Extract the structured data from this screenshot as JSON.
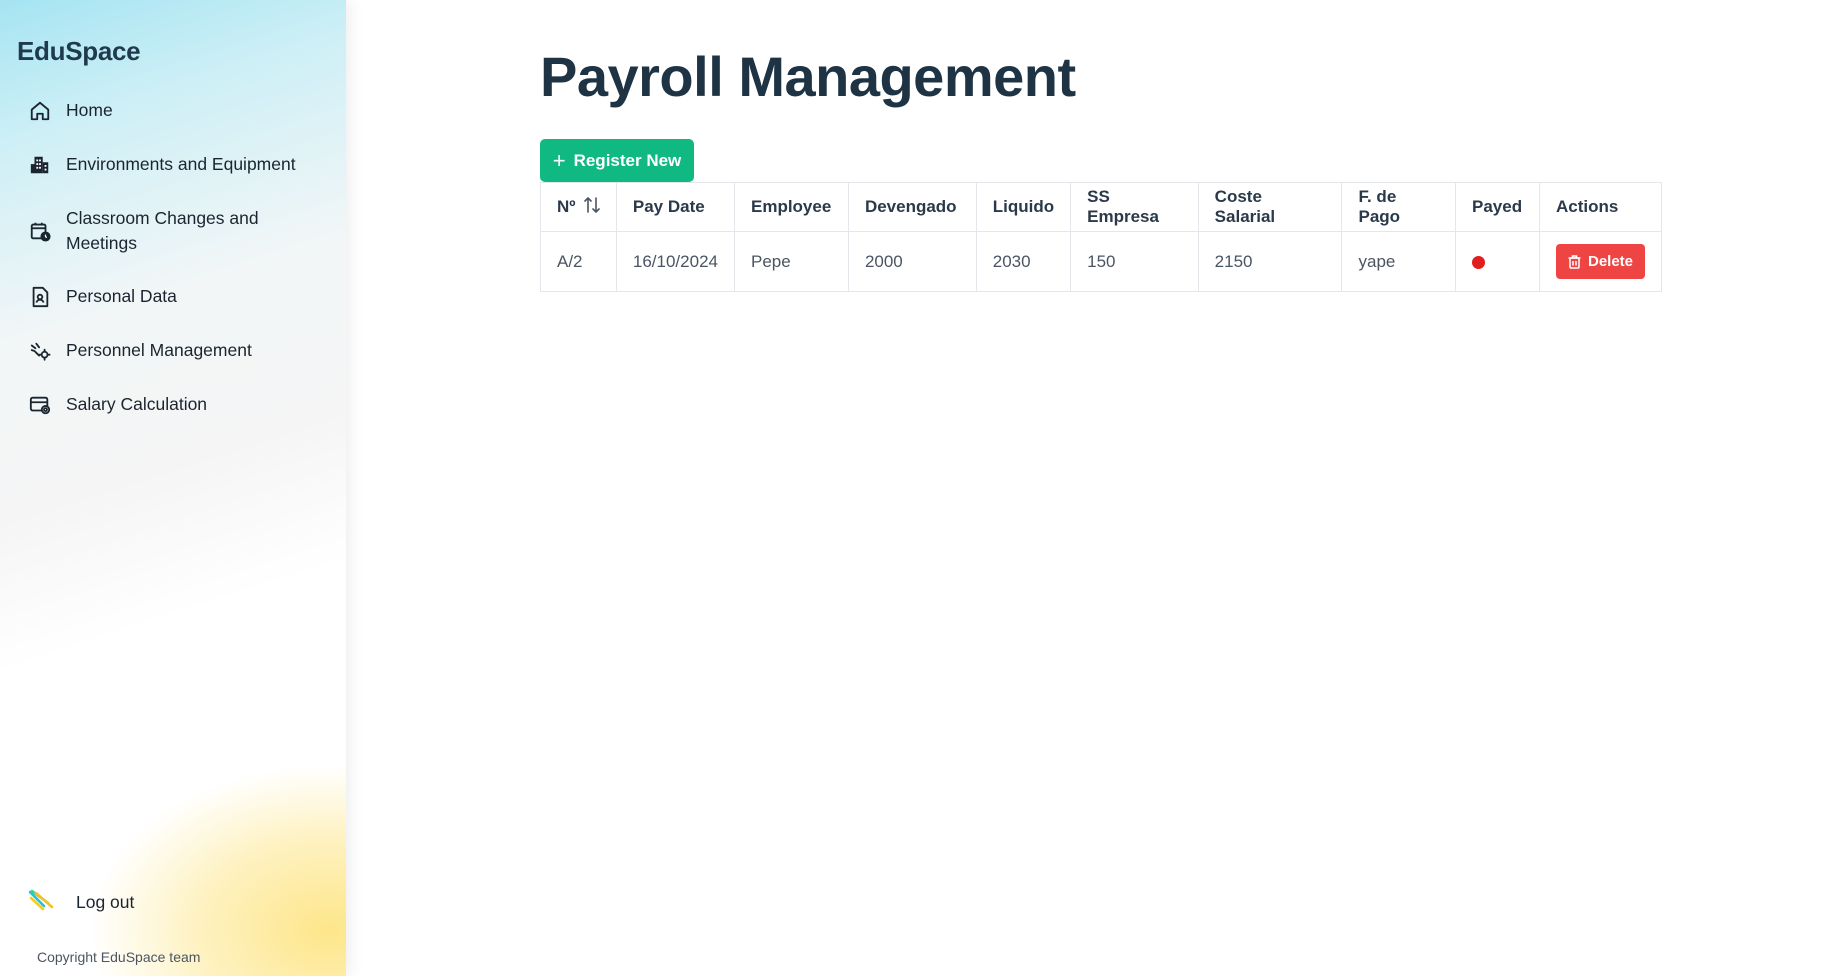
{
  "sidebar": {
    "brand": "EduSpace",
    "items": [
      {
        "label": "Home",
        "icon": "home-icon"
      },
      {
        "label": "Environments and Equipment",
        "icon": "building-icon"
      },
      {
        "label": "Classroom Changes and Meetings",
        "icon": "calendar-clock-icon"
      },
      {
        "label": "Personal Data",
        "icon": "document-user-icon"
      },
      {
        "label": "Personnel Management",
        "icon": "people-gear-icon"
      },
      {
        "label": "Salary Calculation",
        "icon": "card-gear-icon"
      }
    ],
    "logout_label": "Log out",
    "logout_icon": "logout-stripes-icon",
    "copyright": "Copyright EduSpace team"
  },
  "main": {
    "title": "Payroll Management",
    "register_label": "Register New",
    "table": {
      "columns": [
        "Nº",
        "Pay Date",
        "Employee",
        "Devengado",
        "Liquido",
        "SS Empresa",
        "Coste Salarial",
        "F. de Pago",
        "Payed",
        "Actions"
      ],
      "rows": [
        {
          "number": "A/2",
          "pay_date": "16/10/2024",
          "employee": "Pepe",
          "devengado": "2000",
          "liquido": "2030",
          "ss_empresa": "150",
          "coste_salarial": "2150",
          "forma_pago": "yape",
          "payed": false,
          "delete_label": "Delete"
        }
      ]
    }
  },
  "colors": {
    "primary": "#10b981",
    "danger": "#ef4444",
    "unpaid_dot": "#e11d1d",
    "heading": "#1e3344"
  }
}
